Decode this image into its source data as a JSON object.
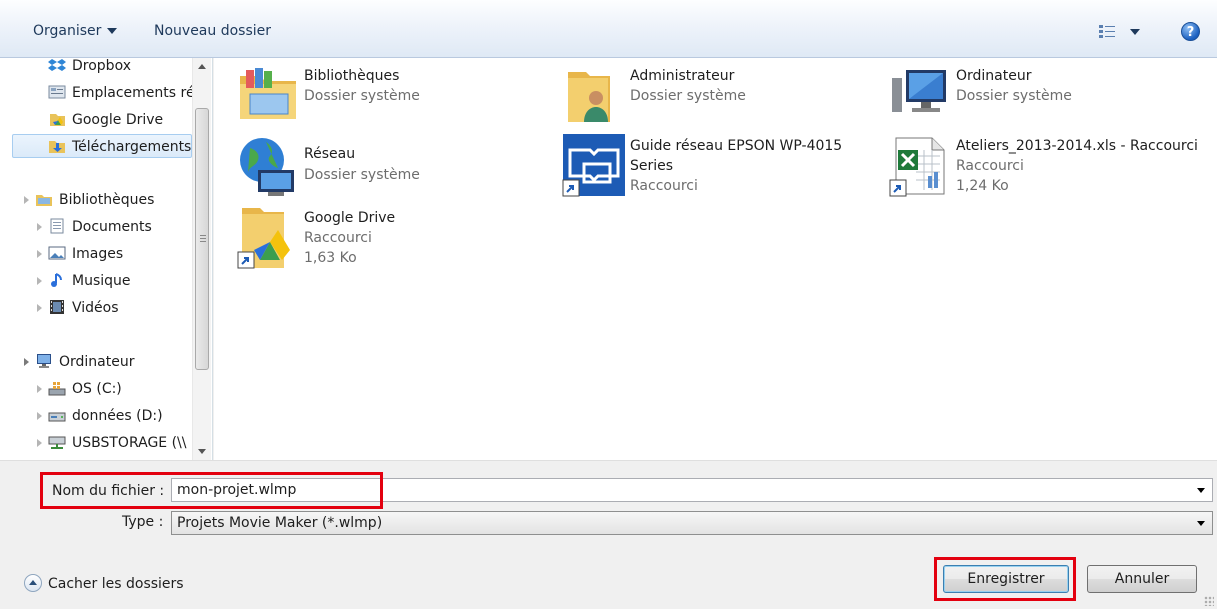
{
  "toolbar": {
    "organise_label": "Organiser",
    "new_folder_label": "Nouveau dossier",
    "help_glyph": "?"
  },
  "nav": {
    "favorites": [
      {
        "label": "Dropbox",
        "icon": "dropbox-icon"
      },
      {
        "label": "Emplacements ré",
        "icon": "recent-places-icon"
      },
      {
        "label": "Google Drive",
        "icon": "google-drive-icon"
      },
      {
        "label": "Téléchargements",
        "icon": "downloads-icon",
        "selected": true
      }
    ],
    "libraries": {
      "label": "Bibliothèques",
      "icon": "libraries-icon"
    },
    "library_items": [
      {
        "label": "Documents",
        "icon": "documents-icon"
      },
      {
        "label": "Images",
        "icon": "images-icon"
      },
      {
        "label": "Musique",
        "icon": "music-icon"
      },
      {
        "label": "Vidéos",
        "icon": "videos-icon"
      }
    ],
    "computer": {
      "label": "Ordinateur",
      "icon": "computer-icon"
    },
    "drives": [
      {
        "label": "OS (C:)",
        "icon": "os-drive-icon"
      },
      {
        "label": "données (D:)",
        "icon": "data-drive-icon"
      },
      {
        "label": "USBSTORAGE (\\\\",
        "icon": "network-drive-icon"
      }
    ]
  },
  "items": [
    {
      "name": "Bibliothèques",
      "line2": "Dossier système",
      "icon": "libraries-folder-icon"
    },
    {
      "name": "Administrateur",
      "line2": "Dossier système",
      "icon": "user-folder-icon"
    },
    {
      "name": "Ordinateur",
      "line2": "Dossier système",
      "icon": "computer-icon"
    },
    {
      "name": "Réseau",
      "line2": "Dossier système",
      "icon": "network-globe-icon"
    },
    {
      "name": "Guide réseau EPSON WP-4015",
      "name2": "Series",
      "line2": "Raccourci",
      "icon": "epson-guide-shortcut-icon"
    },
    {
      "name": "Ateliers_2013-2014.xls - Raccourci",
      "line2": "Raccourci",
      "line3": "1,24 Ko",
      "icon": "excel-shortcut-icon"
    },
    {
      "name": "Google Drive",
      "line2": "Raccourci",
      "line3": "1,63 Ko",
      "icon": "google-drive-shortcut-icon"
    }
  ],
  "form": {
    "filename_label": "Nom du fichier :",
    "filename_value": "mon-projet.wlmp",
    "type_label": "Type :",
    "type_value": "Projets Movie Maker (*.wlmp)",
    "hide_folders_label": "Cacher les dossiers",
    "save_label": "Enregistrer",
    "cancel_label": "Annuler"
  },
  "colors": {
    "highlight": "#e3000f",
    "toolbar_text": "#1e395b",
    "secondary_text": "#6d6d6d"
  }
}
